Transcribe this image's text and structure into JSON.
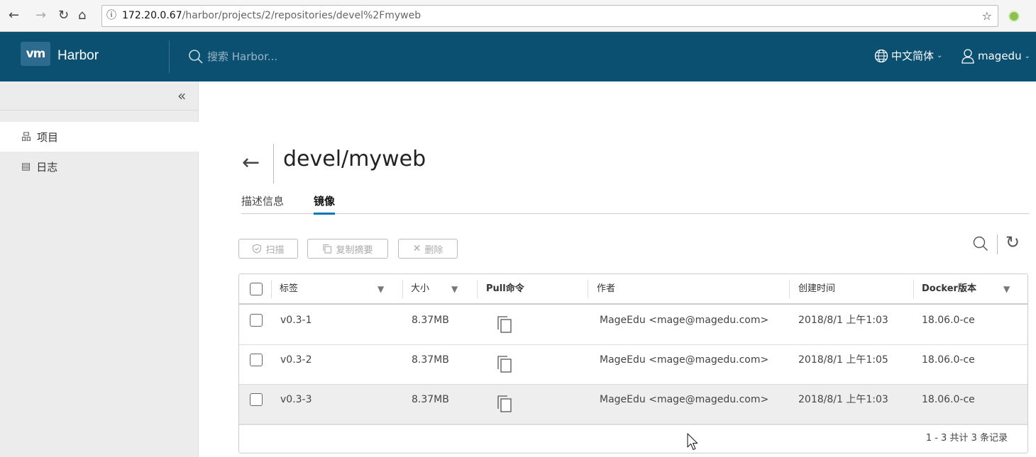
{
  "browser": {
    "url_host": "172.20.0.67",
    "url_path": "/harbor/projects/2/repositories/devel%2Fmyweb"
  },
  "header": {
    "logo_text": "vm",
    "brand": "Harbor",
    "search_placeholder": "搜索 Harbor...",
    "language": "中文简体",
    "username": "magedu"
  },
  "sidebar": {
    "items": [
      {
        "label": "项目",
        "icon": "projects-icon"
      },
      {
        "label": "日志",
        "icon": "logs-icon"
      }
    ]
  },
  "main": {
    "title": "devel/myweb",
    "tabs": [
      {
        "label": "描述信息"
      },
      {
        "label": "镜像"
      }
    ],
    "toolbar": {
      "scan_label": "扫描",
      "copy_digest_label": "复制摘要",
      "delete_label": "删除"
    },
    "table": {
      "columns": [
        "标签",
        "大小",
        "Pull命令",
        "作者",
        "创建时间",
        "Docker版本"
      ],
      "rows": [
        {
          "tag": "v0.3-1",
          "size": "8.37MB",
          "author": "MageEdu <mage@magedu.com>",
          "created": "2018/8/1 上午1:03",
          "docker": "18.06.0-ce"
        },
        {
          "tag": "v0.3-2",
          "size": "8.37MB",
          "author": "MageEdu <mage@magedu.com>",
          "created": "2018/8/1 上午1:05",
          "docker": "18.06.0-ce"
        },
        {
          "tag": "v0.3-3",
          "size": "8.37MB",
          "author": "MageEdu <mage@magedu.com>",
          "created": "2018/8/1 上午1:03",
          "docker": "18.06.0-ce"
        }
      ],
      "footer": "1 - 3 共计 3 条记录"
    }
  },
  "colors": {
    "header_bg": "#0b4f71",
    "tab_accent": "#0077b8",
    "sidebar_bg": "#ececec"
  }
}
